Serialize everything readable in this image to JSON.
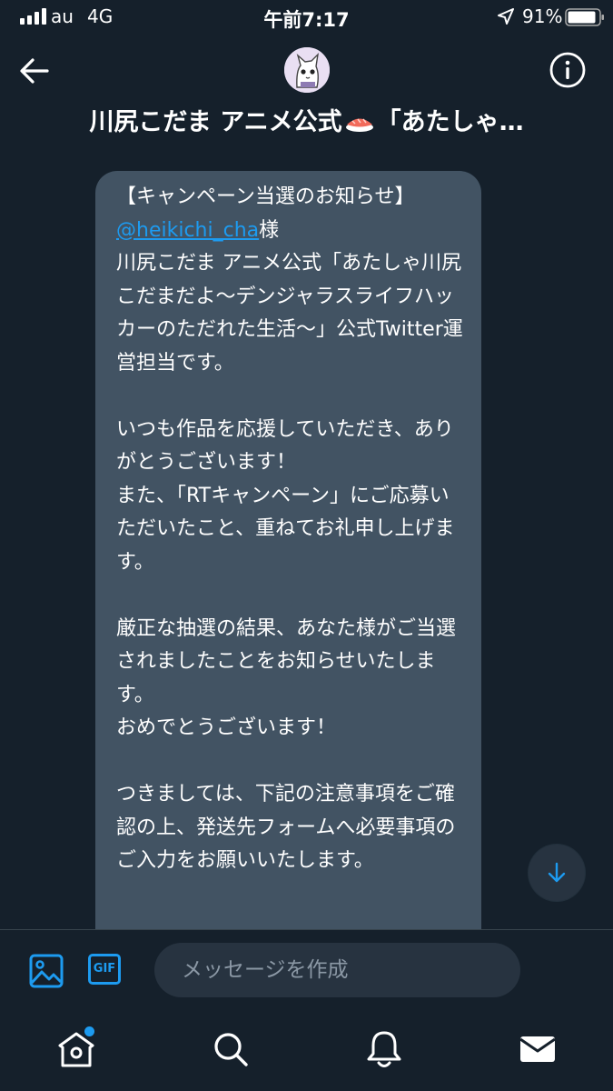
{
  "status_bar": {
    "carrier": "au",
    "network": "4G",
    "time": "午前7:17",
    "battery": "91%",
    "battery_level": 0.91
  },
  "header": {
    "title": "川尻こだま アニメ公式",
    "title_suffix": "「あたしゃ…"
  },
  "message": {
    "line1": "【キャンペーン当選のお知らせ】",
    "mention": "@heikichi_cha",
    "honorific": "様",
    "body": "川尻こだま アニメ公式「あたしゃ川尻こだまだよ〜デンジャラスライフハッカーのただれた生活〜」公式Twitter運営担当です。\n\nいつも作品を応援していただき、ありがとうございます！\nまた、「RTキャンペーン」にご応募いただいたこと、重ねてお礼申し上げます。\n\n厳正な抽選の結果、あなた様がご当選されましたことをお知らせいたします。\nおめでとうございます！\n\nつきましては、下記の注意事項をご確認の上、発送先フォームへ必要事項のご入力をお願いいたします。"
  },
  "composer": {
    "gif_label": "GIF",
    "placeholder": "メッセージを作成"
  },
  "colors": {
    "background": "#15202b",
    "bubble": "#425363",
    "accent": "#1d9bf0",
    "voice": "#a05cff"
  },
  "icons": [
    "back-arrow-icon",
    "info-icon",
    "media-icon",
    "gif-icon",
    "voice-icon",
    "home-icon",
    "search-icon",
    "bell-icon",
    "mail-icon",
    "arrow-down-icon"
  ]
}
